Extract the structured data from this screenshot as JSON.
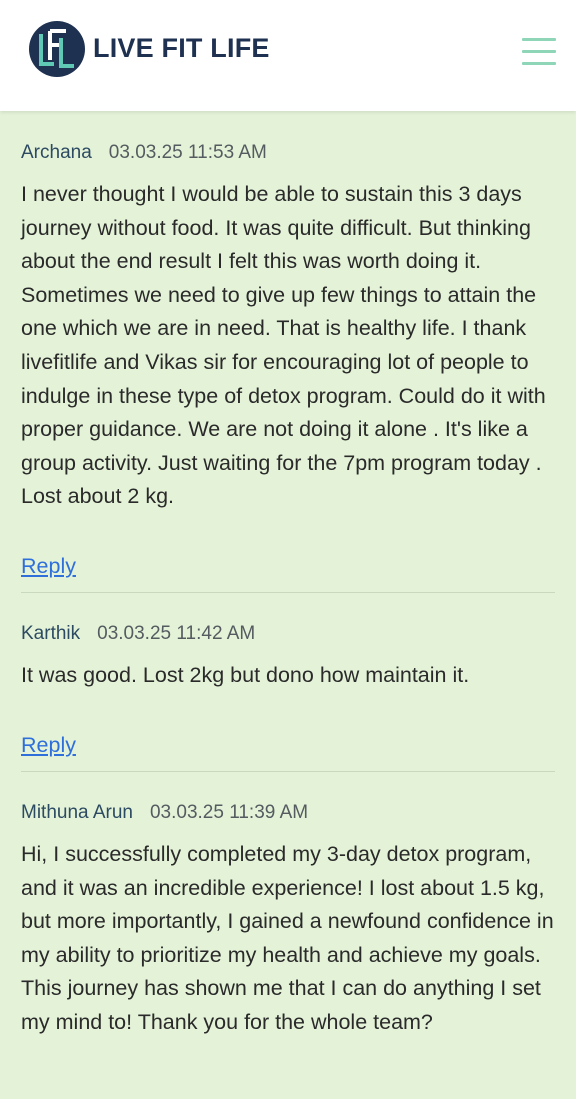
{
  "header": {
    "brand": "LIVE FIT LIFE",
    "logo_letters": "LFL",
    "logo_colors": {
      "circle": "#1f3150",
      "accent": "#5fc9b5"
    },
    "menu_icon": "hamburger-icon"
  },
  "comments": [
    {
      "author": "Archana",
      "date": "03.03.25 11:53 AM",
      "text": "I never thought I would be able to sustain this 3 days journey without food. It was quite difficult. But thinking about the end result I felt this was worth doing it. Sometimes we need to give up few things to attain the one which we are in need. That is healthy life. I thank livefitlife and Vikas sir for encouraging lot of people to indulge in these type of detox program. Could do it with proper guidance. We are not doing it alone . It's like a group activity. Just waiting for the 7pm program today . Lost about 2 kg.",
      "reply_label": "Reply"
    },
    {
      "author": "Karthik",
      "date": "03.03.25 11:42 AM",
      "text": "It was good. Lost 2kg but dono how maintain it.",
      "reply_label": "Reply"
    },
    {
      "author": "Mithuna Arun",
      "date": "03.03.25 11:39 AM",
      "text": "Hi, I successfully completed my 3-day detox program, and it was an incredible experience! I lost about 1.5 kg, but more importantly, I gained a newfound confidence in my ability to prioritize my health and achieve my goals. This journey has shown me that I can do anything I set my mind to! Thank you for the whole team?"
    }
  ],
  "colors": {
    "page_background": "#e4f3d8",
    "link": "#2f6fdc",
    "author": "#2c4a62",
    "brand_text": "#1f3150",
    "menu_icon": "#8fd6b8"
  }
}
